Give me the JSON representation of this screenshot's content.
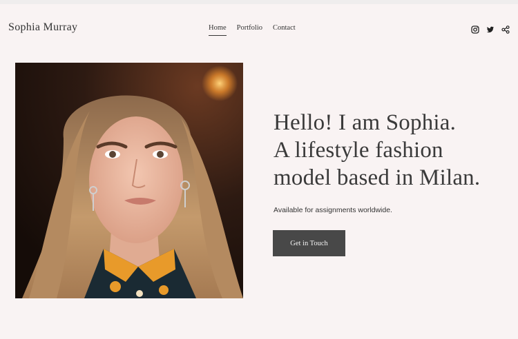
{
  "header": {
    "brand": "Sophia Murray",
    "nav": [
      {
        "label": "Home",
        "active": true
      },
      {
        "label": "Portfolio",
        "active": false
      },
      {
        "label": "Contact",
        "active": false
      }
    ],
    "social_icons": [
      "instagram-icon",
      "twitter-icon",
      "share-icon"
    ]
  },
  "hero": {
    "headline_lines": [
      "Hello! I am Sophia.",
      "A lifestyle fashion",
      "model based in Milan."
    ],
    "subtitle": "Available for assignments worldwide.",
    "cta_label": "Get in Touch"
  },
  "colors": {
    "background": "#f9f3f3",
    "button": "#484848",
    "text": "#3b3b3b"
  }
}
